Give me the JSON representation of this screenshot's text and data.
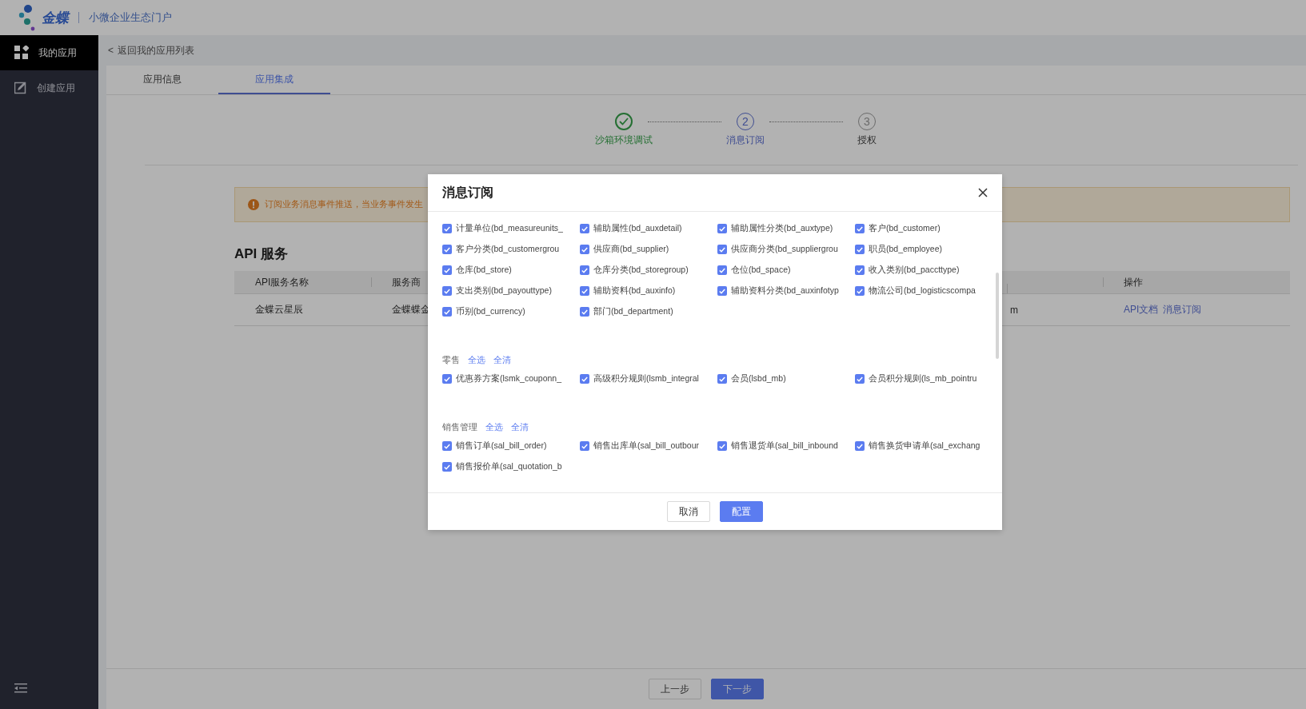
{
  "header": {
    "brand": "金蝶",
    "portal": "小微企业生态门户"
  },
  "sidebar": {
    "items": [
      {
        "label": "我的应用",
        "selected": true
      },
      {
        "label": "创建应用",
        "selected": false
      }
    ]
  },
  "back_link": {
    "arrow": "<",
    "label": "返回我的应用列表"
  },
  "tabs": [
    {
      "label": "应用信息",
      "selected": false
    },
    {
      "label": "应用集成",
      "selected": true
    }
  ],
  "steps": [
    {
      "done": true,
      "selected": false,
      "label": "沙箱环境调试"
    },
    {
      "done": false,
      "selected": true,
      "number": "2",
      "label": "消息订阅"
    },
    {
      "done": false,
      "selected": false,
      "number": "3",
      "label": "授权"
    }
  ],
  "alert": {
    "text": "订阅业务消息事件推送，当业务事件发生"
  },
  "api_section": {
    "title": "API 服务",
    "columns": [
      "API服务名称",
      "服务商",
      "操作"
    ],
    "rows": [
      {
        "name": "金蝶云星辰",
        "provider": "金蝶蝶金",
        "column_3": "m",
        "actions": [
          "API文档",
          "消息订阅"
        ]
      }
    ]
  },
  "modal": {
    "title": "消息订阅",
    "groups": [
      {
        "items": [
          {
            "label": "计量单位(bd_measureunits_",
            "checked": true
          },
          {
            "label": "辅助属性(bd_auxdetail)",
            "checked": true
          },
          {
            "label": "辅助属性分类(bd_auxtype)",
            "checked": true
          },
          {
            "label": "客户(bd_customer)",
            "checked": true
          },
          {
            "label": "客户分类(bd_customergrou",
            "checked": true
          },
          {
            "label": "供应商(bd_supplier)",
            "checked": true
          },
          {
            "label": "供应商分类(bd_suppliergrou",
            "checked": true
          },
          {
            "label": "职员(bd_employee)",
            "checked": true
          },
          {
            "label": "仓库(bd_store)",
            "checked": true
          },
          {
            "label": "仓库分类(bd_storegroup)",
            "checked": true
          },
          {
            "label": "仓位(bd_space)",
            "checked": true
          },
          {
            "label": "收入类别(bd_paccttype)",
            "checked": true
          },
          {
            "label": "支出类别(bd_payouttype)",
            "checked": true
          },
          {
            "label": "辅助资料(bd_auxinfo)",
            "checked": true
          },
          {
            "label": "辅助资料分类(bd_auxinfotyp",
            "checked": true
          },
          {
            "label": "物流公司(bd_logisticscompa",
            "checked": true
          },
          {
            "label": "币别(bd_currency)",
            "checked": true
          },
          {
            "label": "部门(bd_department)",
            "checked": true
          }
        ]
      },
      {
        "name": "零售",
        "select_all": "全选",
        "clear_all": "全清",
        "items": [
          {
            "label": "优惠券方案(lsmk_couponn_",
            "checked": true
          },
          {
            "label": "高级积分规则(lsmb_integral",
            "checked": true
          },
          {
            "label": "会员(lsbd_mb)",
            "checked": true
          },
          {
            "label": "会员积分规则(ls_mb_pointru",
            "checked": true
          }
        ]
      },
      {
        "name": "销售管理",
        "select_all": "全选",
        "clear_all": "全清",
        "items": [
          {
            "label": "销售订单(sal_bill_order)",
            "checked": true
          },
          {
            "label": "销售出库单(sal_bill_outbour",
            "checked": true
          },
          {
            "label": "销售退货单(sal_bill_inbound",
            "checked": true
          },
          {
            "label": "销售换货申请单(sal_exchang",
            "checked": true
          },
          {
            "label": "销售报价单(sal_quotation_b",
            "checked": true
          }
        ]
      }
    ],
    "buttons": [
      {
        "label": "取消",
        "kind": "default"
      },
      {
        "label": "配置",
        "kind": "primary"
      }
    ]
  },
  "footer": {
    "buttons": [
      {
        "label": "上一步",
        "kind": "default"
      },
      {
        "label": "下一步",
        "kind": "primary"
      }
    ]
  }
}
